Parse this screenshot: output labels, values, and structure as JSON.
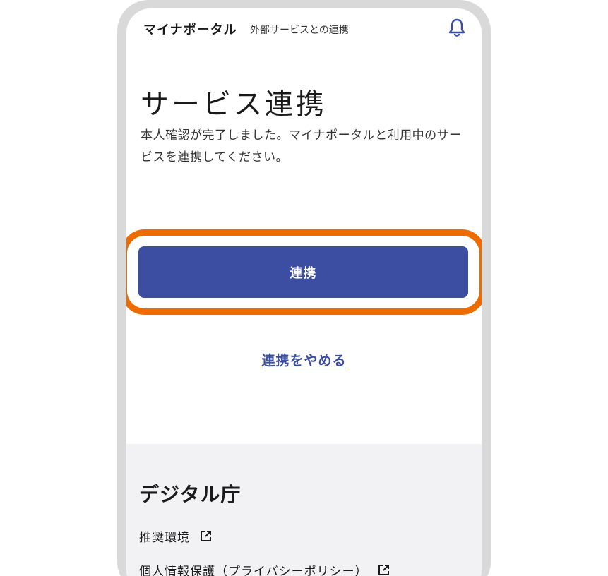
{
  "header": {
    "app_title": "マイナポータル",
    "subtitle": "外部サービスとの連携",
    "notification_icon": "bell-icon"
  },
  "main": {
    "title": "サービス連携",
    "description": "本人確認が完了しました。マイナポータルと利用中のサービスを連携してください。",
    "primary_button_label": "連携",
    "cancel_link_label": "連携をやめる"
  },
  "footer": {
    "title": "デジタル庁",
    "links": [
      {
        "label": "推奨環境",
        "icon": "external-link-icon"
      },
      {
        "label": "個人情報保護（プライバシーポリシー）",
        "icon": "external-link-icon"
      }
    ]
  },
  "colors": {
    "primary": "#3b4ea2",
    "highlight": "#ec6c00",
    "frame": "#d9d9d9",
    "footer_bg": "#f2f2f4"
  }
}
